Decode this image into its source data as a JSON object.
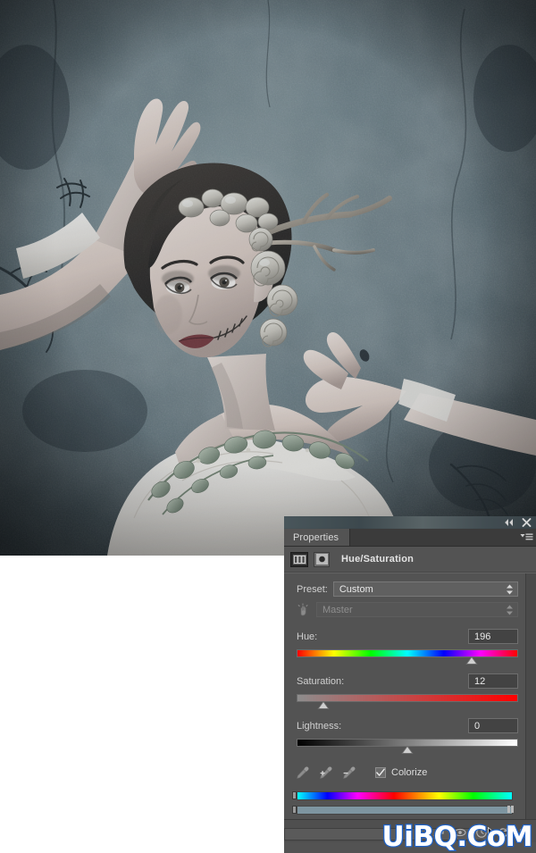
{
  "app": {
    "panel_tab": "Properties",
    "adjustment_title": "Hue/Saturation"
  },
  "panel": {
    "collapse_icon": "double-left-arrow-icon",
    "close_icon": "close-icon",
    "menu_icon": "panel-menu-icon",
    "adjustment_layer_icon": "hue-saturation-adjustment-icon",
    "target_adjustment_icon": "on-image-adjustment-icon",
    "preset_label": "Preset:",
    "preset_value": "Custom",
    "channel_value": "Master",
    "channel_hand_icon": "targeted-adjustment-hand-icon",
    "sliders": [
      {
        "label": "Hue:",
        "value": "196",
        "percent": 79
      },
      {
        "label": "Saturation:",
        "value": "12",
        "percent": 12
      },
      {
        "label": "Lightness:",
        "value": "0",
        "percent": 50
      }
    ],
    "tools": [
      {
        "name": "eyedropper-icon"
      },
      {
        "name": "eyedropper-add-icon"
      },
      {
        "name": "eyedropper-subtract-icon"
      }
    ],
    "colorize_label": "Colorize",
    "colorize_checked": true,
    "footer_icons": [
      "clip-to-layer-icon",
      "toggle-visibility-icon",
      "view-previous-state-icon",
      "reset-icon",
      "delete-icon"
    ]
  },
  "watermark": {
    "text": "UiBQ.CoM",
    "fill": "#ffffff",
    "stroke": "#1f63c8"
  },
  "colors": {
    "panel_bg": "#535353",
    "panel_dark": "#3b3b3b",
    "field_bg": "#434343",
    "text": "#d2d2d2",
    "photo_base": "#47565c"
  }
}
